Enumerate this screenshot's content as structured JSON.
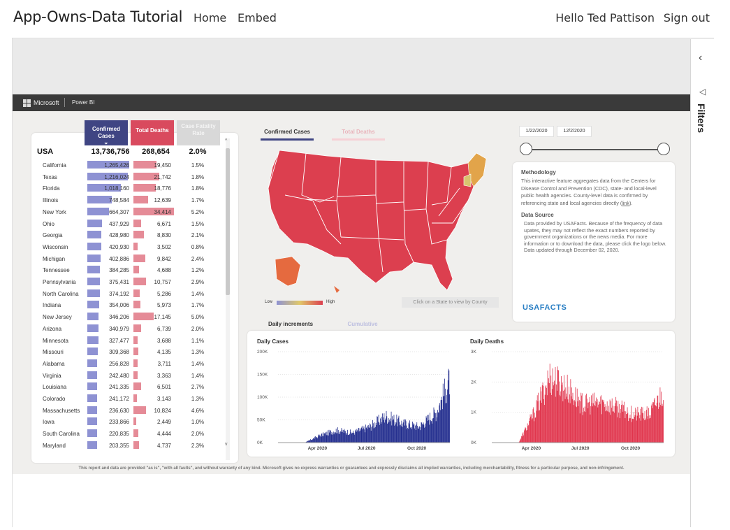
{
  "app": {
    "title": "App-Owns-Data Tutorial",
    "nav": [
      "Home",
      "Embed"
    ],
    "greeting": "Hello Ted Pattison",
    "signout": "Sign out"
  },
  "pbi": {
    "microsoft": "Microsoft",
    "product": "Power BI"
  },
  "filters": {
    "label": "Filters",
    "collapse_icon": "chevron-left-icon",
    "funnel_icon": "filter-icon"
  },
  "table": {
    "headers": {
      "confirmed": "Confirmed Cases",
      "deaths": "Total Deaths",
      "rate": "Case Fatality Rate"
    },
    "total": {
      "name": "USA",
      "confirmed": "13,736,756",
      "deaths": "268,654",
      "rate": "2.0%"
    },
    "rows": [
      {
        "state": "California",
        "confirmed": "1,265,426",
        "deaths": "19,450",
        "rate": "1.5%",
        "cv": 1265426,
        "dv": 19450
      },
      {
        "state": "Texas",
        "confirmed": "1,216,024",
        "deaths": "21,742",
        "rate": "1.8%",
        "cv": 1216024,
        "dv": 21742
      },
      {
        "state": "Florida",
        "confirmed": "1,018,160",
        "deaths": "18,776",
        "rate": "1.8%",
        "cv": 1018160,
        "dv": 18776
      },
      {
        "state": "Illinois",
        "confirmed": "748,584",
        "deaths": "12,639",
        "rate": "1.7%",
        "cv": 748584,
        "dv": 12639
      },
      {
        "state": "New York",
        "confirmed": "664,307",
        "deaths": "34,414",
        "rate": "5.2%",
        "cv": 664307,
        "dv": 34414
      },
      {
        "state": "Ohio",
        "confirmed": "437,929",
        "deaths": "6,671",
        "rate": "1.5%",
        "cv": 437929,
        "dv": 6671
      },
      {
        "state": "Georgia",
        "confirmed": "428,980",
        "deaths": "8,830",
        "rate": "2.1%",
        "cv": 428980,
        "dv": 8830
      },
      {
        "state": "Wisconsin",
        "confirmed": "420,930",
        "deaths": "3,502",
        "rate": "0.8%",
        "cv": 420930,
        "dv": 3502
      },
      {
        "state": "Michigan",
        "confirmed": "402,886",
        "deaths": "9,842",
        "rate": "2.4%",
        "cv": 402886,
        "dv": 9842
      },
      {
        "state": "Tennessee",
        "confirmed": "384,285",
        "deaths": "4,688",
        "rate": "1.2%",
        "cv": 384285,
        "dv": 4688
      },
      {
        "state": "Pennsylvania",
        "confirmed": "375,431",
        "deaths": "10,757",
        "rate": "2.9%",
        "cv": 375431,
        "dv": 10757
      },
      {
        "state": "North Carolina",
        "confirmed": "374,192",
        "deaths": "5,286",
        "rate": "1.4%",
        "cv": 374192,
        "dv": 5286
      },
      {
        "state": "Indiana",
        "confirmed": "354,006",
        "deaths": "5,973",
        "rate": "1.7%",
        "cv": 354006,
        "dv": 5973
      },
      {
        "state": "New Jersey",
        "confirmed": "346,206",
        "deaths": "17,145",
        "rate": "5.0%",
        "cv": 346206,
        "dv": 17145
      },
      {
        "state": "Arizona",
        "confirmed": "340,979",
        "deaths": "6,739",
        "rate": "2.0%",
        "cv": 340979,
        "dv": 6739
      },
      {
        "state": "Minnesota",
        "confirmed": "327,477",
        "deaths": "3,688",
        "rate": "1.1%",
        "cv": 327477,
        "dv": 3688
      },
      {
        "state": "Missouri",
        "confirmed": "309,368",
        "deaths": "4,135",
        "rate": "1.3%",
        "cv": 309368,
        "dv": 4135
      },
      {
        "state": "Alabama",
        "confirmed": "256,828",
        "deaths": "3,711",
        "rate": "1.4%",
        "cv": 256828,
        "dv": 3711
      },
      {
        "state": "Virginia",
        "confirmed": "242,480",
        "deaths": "3,363",
        "rate": "1.4%",
        "cv": 242480,
        "dv": 3363
      },
      {
        "state": "Louisiana",
        "confirmed": "241,335",
        "deaths": "6,501",
        "rate": "2.7%",
        "cv": 241335,
        "dv": 6501
      },
      {
        "state": "Colorado",
        "confirmed": "241,172",
        "deaths": "3,143",
        "rate": "1.3%",
        "cv": 241172,
        "dv": 3143
      },
      {
        "state": "Massachusetts",
        "confirmed": "236,630",
        "deaths": "10,824",
        "rate": "4.6%",
        "cv": 236630,
        "dv": 10824
      },
      {
        "state": "Iowa",
        "confirmed": "233,866",
        "deaths": "2,449",
        "rate": "1.0%",
        "cv": 233866,
        "dv": 2449
      },
      {
        "state": "South Carolina",
        "confirmed": "220,835",
        "deaths": "4,444",
        "rate": "2.0%",
        "cv": 220835,
        "dv": 4444
      },
      {
        "state": "Maryland",
        "confirmed": "203,355",
        "deaths": "4,737",
        "rate": "2.3%",
        "cv": 203355,
        "dv": 4737
      }
    ]
  },
  "map": {
    "tabs": [
      "Confirmed Cases",
      "Total Deaths"
    ],
    "legend_low": "Low",
    "legend_high": "High",
    "hint": "Click on a State to view by County"
  },
  "dates": {
    "start": "1/22/2020",
    "end": "12/2/2020"
  },
  "methodology": {
    "title": "Methodology",
    "text": "This interactive feature aggregates data from the Centers for Disease Control and Prevention (CDC), state- and local-level public health agencies. County-level data is confirmed by referencing state and local agencies directly (",
    "link": "link",
    "text_end": ").",
    "source_title": "Data Source",
    "source_text": "Data provided by USAFacts. Because of the frequency of data upates, they may not reflect the exact numbers reported by government organizations or the news media. For more information or to download the data, please click the logo below. Data updated through December 02, 2020.",
    "logo": "USAFACTS"
  },
  "trend_tabs": [
    "Daily increments",
    "Cumulative"
  ],
  "charts": {
    "cases": {
      "title": "Daily Cases",
      "yticks": [
        "200K",
        "150K",
        "100K",
        "50K",
        "0K"
      ],
      "xticks": [
        "Apr 2020",
        "Jul 2020",
        "Oct 2020"
      ]
    },
    "deaths": {
      "title": "Daily Deaths",
      "yticks": [
        "3K",
        "2K",
        "1K",
        "0K"
      ],
      "xticks": [
        "Apr 2020",
        "Jul 2020",
        "Oct 2020"
      ]
    }
  },
  "chart_data": [
    {
      "type": "bar",
      "title": "Daily Cases",
      "x_range": [
        "2020-01-22",
        "2020-12-02"
      ],
      "ylim": [
        0,
        200000
      ],
      "series": [
        {
          "name": "Daily Cases",
          "approx_monthly_peaks": [
            [
              "2020-03",
              20000
            ],
            [
              "2020-04",
              35000
            ],
            [
              "2020-05",
              28000
            ],
            [
              "2020-06",
              45000
            ],
            [
              "2020-07",
              75000
            ],
            [
              "2020-08",
              55000
            ],
            [
              "2020-09",
              45000
            ],
            [
              "2020-10",
              85000
            ],
            [
              "2020-11",
              195000
            ],
            [
              "2020-12",
              200000
            ]
          ]
        }
      ],
      "xlabel": "",
      "ylabel": ""
    },
    {
      "type": "bar",
      "title": "Daily Deaths",
      "x_range": [
        "2020-01-22",
        "2020-12-02"
      ],
      "ylim": [
        0,
        3000
      ],
      "series": [
        {
          "name": "Daily Deaths",
          "approx_monthly_peaks": [
            [
              "2020-03",
              1200
            ],
            [
              "2020-04",
              2800
            ],
            [
              "2020-05",
              2300
            ],
            [
              "2020-06",
              1600
            ],
            [
              "2020-07",
              1700
            ],
            [
              "2020-08",
              1500
            ],
            [
              "2020-09",
              1200
            ],
            [
              "2020-10",
              1200
            ],
            [
              "2020-11",
              2400
            ],
            [
              "2020-12",
              2800
            ]
          ]
        }
      ],
      "xlabel": "",
      "ylabel": ""
    }
  ],
  "footer": "This report and data are provided \"as is\", \"with all faults\", and without warranty of any kind. Microsoft gives no express warranties or guarantees and expressly disclaims all implied warranties, including merchantability, fitness for a particular purpose, and non-infringement.",
  "colors": {
    "confirmed": "#3f4583",
    "deaths": "#d94a5e",
    "rate": "#d8d8d8",
    "map": "#dc3f4f",
    "cases_bar": "#1f2a8c",
    "deaths_bar": "#e0324a"
  }
}
